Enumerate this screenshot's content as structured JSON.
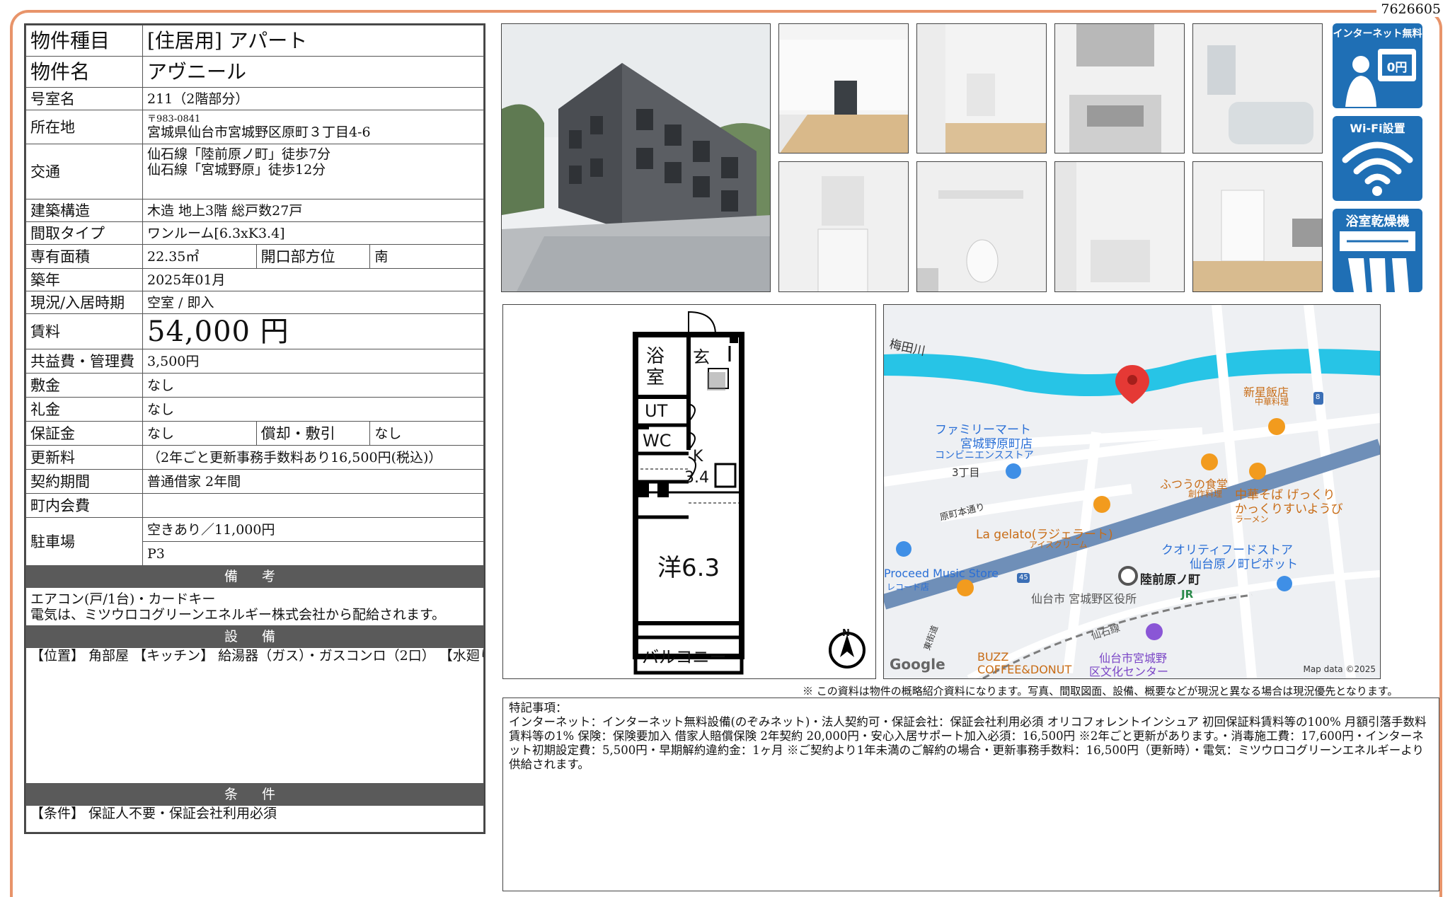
{
  "doc_id": "7626605",
  "table": {
    "rows": [
      {
        "label": "物件種目",
        "value": "[住居用]  アパート"
      },
      {
        "label": "物件名",
        "value": "アヴニール"
      },
      {
        "label": "号室名",
        "value": "211（2階部分）"
      },
      {
        "label": "所在地",
        "postal": "〒983-0841",
        "value": "宮城県仙台市宮城野区原町３丁目4-6"
      },
      {
        "label": "交通",
        "line1": "仙石線「陸前原ノ町」徒歩7分",
        "line2": "仙石線「宮城野原」徒歩12分"
      },
      {
        "label": "建築構造",
        "value": "木造 地上3階 総戸数27戸"
      },
      {
        "label": "間取タイプ",
        "value": "ワンルーム[6.3xK3.4]"
      },
      {
        "label": "専有面積",
        "value": "22.35㎡",
        "label2": "開口部方位",
        "value2": "南"
      },
      {
        "label": "築年",
        "value": "2025年01月"
      },
      {
        "label": "現況/入居時期",
        "value": "空室 /  即入"
      },
      {
        "label": "賃料",
        "value": "54,000 円"
      },
      {
        "label": "共益費・管理費",
        "value": "3,500円"
      },
      {
        "label": "敷金",
        "value": "なし"
      },
      {
        "label": "礼金",
        "value": "なし"
      },
      {
        "label": "保証金",
        "value": "なし",
        "label2": "償却・敷引",
        "value2": "なし"
      },
      {
        "label": "更新料",
        "value": "（2年ごと更新事務手数料あり16,500円(税込)）"
      },
      {
        "label": "契約期間",
        "value": "普通借家 2年間"
      },
      {
        "label": "町内会費",
        "value": ""
      },
      {
        "label": "駐車場",
        "value": "空きあり／11,000円",
        "value_sub": "P3"
      }
    ]
  },
  "remarks": {
    "title": "備 考",
    "line1": "エアコン(戸/1台)・カードキー",
    "line2": "電気は、ミツウロコグリーンエネルギー株式会社から配給されます。"
  },
  "facilities": {
    "title": "設 備",
    "text": "【位置】 角部屋 【キッチン】 給湯器（ガス）・ガスコンロ（2口） 【水廻り】 風呂（ユニットバス）・トイレ（水洗）・洗面台（独立）・浴室乾燥機・暖房便座・シャワートイレ・追い焚き・洗髪洗面化粧台・バス・トイレ別・洗濯機置場（室内） 【冷暖房】 エアコン 【収納】 シューズボックス 【放送・通信】 インターネット対応・ネット使用料不要・W-Fi 【セキュリティ】 オートロック・宅配BOX・インターホン（カメラ付き） 【その他】 専用ごみ置場・自転車置場・電気・ガス（プロパンガス）・水道（公営）・排水（公共下水）・バルコニー／ベランダ・網戸・複層ガラス・ペアガラス・24時間換気システム・フローリング・室内物干"
  },
  "conditions": {
    "title": "条 件",
    "text": "【条件】 保証人不要・保証会社利用必須"
  },
  "badges": [
    {
      "label": "インターネット無料",
      "sub": "0円",
      "icon": "free-internet-icon"
    },
    {
      "label": "Wi-Fi設置",
      "icon": "wifi-icon"
    },
    {
      "label": "浴室乾燥機",
      "icon": "bathroom-dryer-icon"
    }
  ],
  "floorplan": {
    "bath": "浴室",
    "entrance": "玄",
    "ut": "UT",
    "wc": "WC",
    "kitchen": "K",
    "kitchen_size": "3.4",
    "room": "洋6.3",
    "balcony": "バルコニー",
    "north": "N"
  },
  "map": {
    "labels": {
      "river": "梅田川",
      "shinsei_name": "新星飯店",
      "shinsei_sub": "中華料理",
      "family_name": "ファミリーマート",
      "family_branch": "宮城野原町店",
      "family_sub": "コンビニエンスストア",
      "chome": "3丁目",
      "futsu_name": "ふつうの食堂",
      "futsu_sub": "創作料理",
      "chuka_name": "中華そば げっくり",
      "chuka_line2": "かっくりすいようび",
      "chuka_sub": "ラーメン",
      "haramachi": "原町本通り",
      "gelato_name": "La gelato(ラジェラート)",
      "gelato_sub": "アイスクリーム",
      "quality_name": "クオリティフードストア",
      "quality_branch": "仙台原ノ町ピボット",
      "proceed_name": "Proceed Music Store",
      "proceed_sub": "レコード店",
      "rikuzen": "陸前原ノ町",
      "ward_office": "仙台市 宮城野区役所",
      "jr": "JR",
      "road45": "45",
      "route8": "8",
      "senseki": "仙石線",
      "higashi": "東街道",
      "buzz_name": "BUZZ",
      "buzz_sub": "COFFEE&DONUT",
      "culture_name": "仙台市宮城野",
      "culture_sub": "区文化センター",
      "google": "Google",
      "mapdata": "Map data ©2025"
    }
  },
  "footnote": "※ この資料は物件の概略紹介資料になります。写真、間取図面、設備、概要などが現況と異なる場合は現況優先となります。",
  "special": {
    "title": "特記事項：",
    "text": "インターネット：インターネット無料設備(のぞみネット)・法人契約可・保証会社：保証会社利用必須 オリコフォレントインシュア 初回保証料賃料等の100% 月額引落手数料賃料等の1% 保険：保険要加入 借家人賠償保険 2年契約 20,000円・安心入居サポート加入必須：16,500円 ※2年ごと更新があります。・消毒施工費：17,600円・インターネット初期設定費：5,500円・早期解約違約金：1ヶ月 ※ご契約より1年未満のご解約の場合・更新事務手数料：16,500円（更新時）・電気：ミツウロコグリーンエネルギーより供給されます。"
  },
  "colors": {
    "frame": "#e8946a",
    "section": "#5a5a5a",
    "badge": "#1f6fb5",
    "river": "#27c4e6",
    "road": "#6f8fb8",
    "pin": "#e53935"
  }
}
